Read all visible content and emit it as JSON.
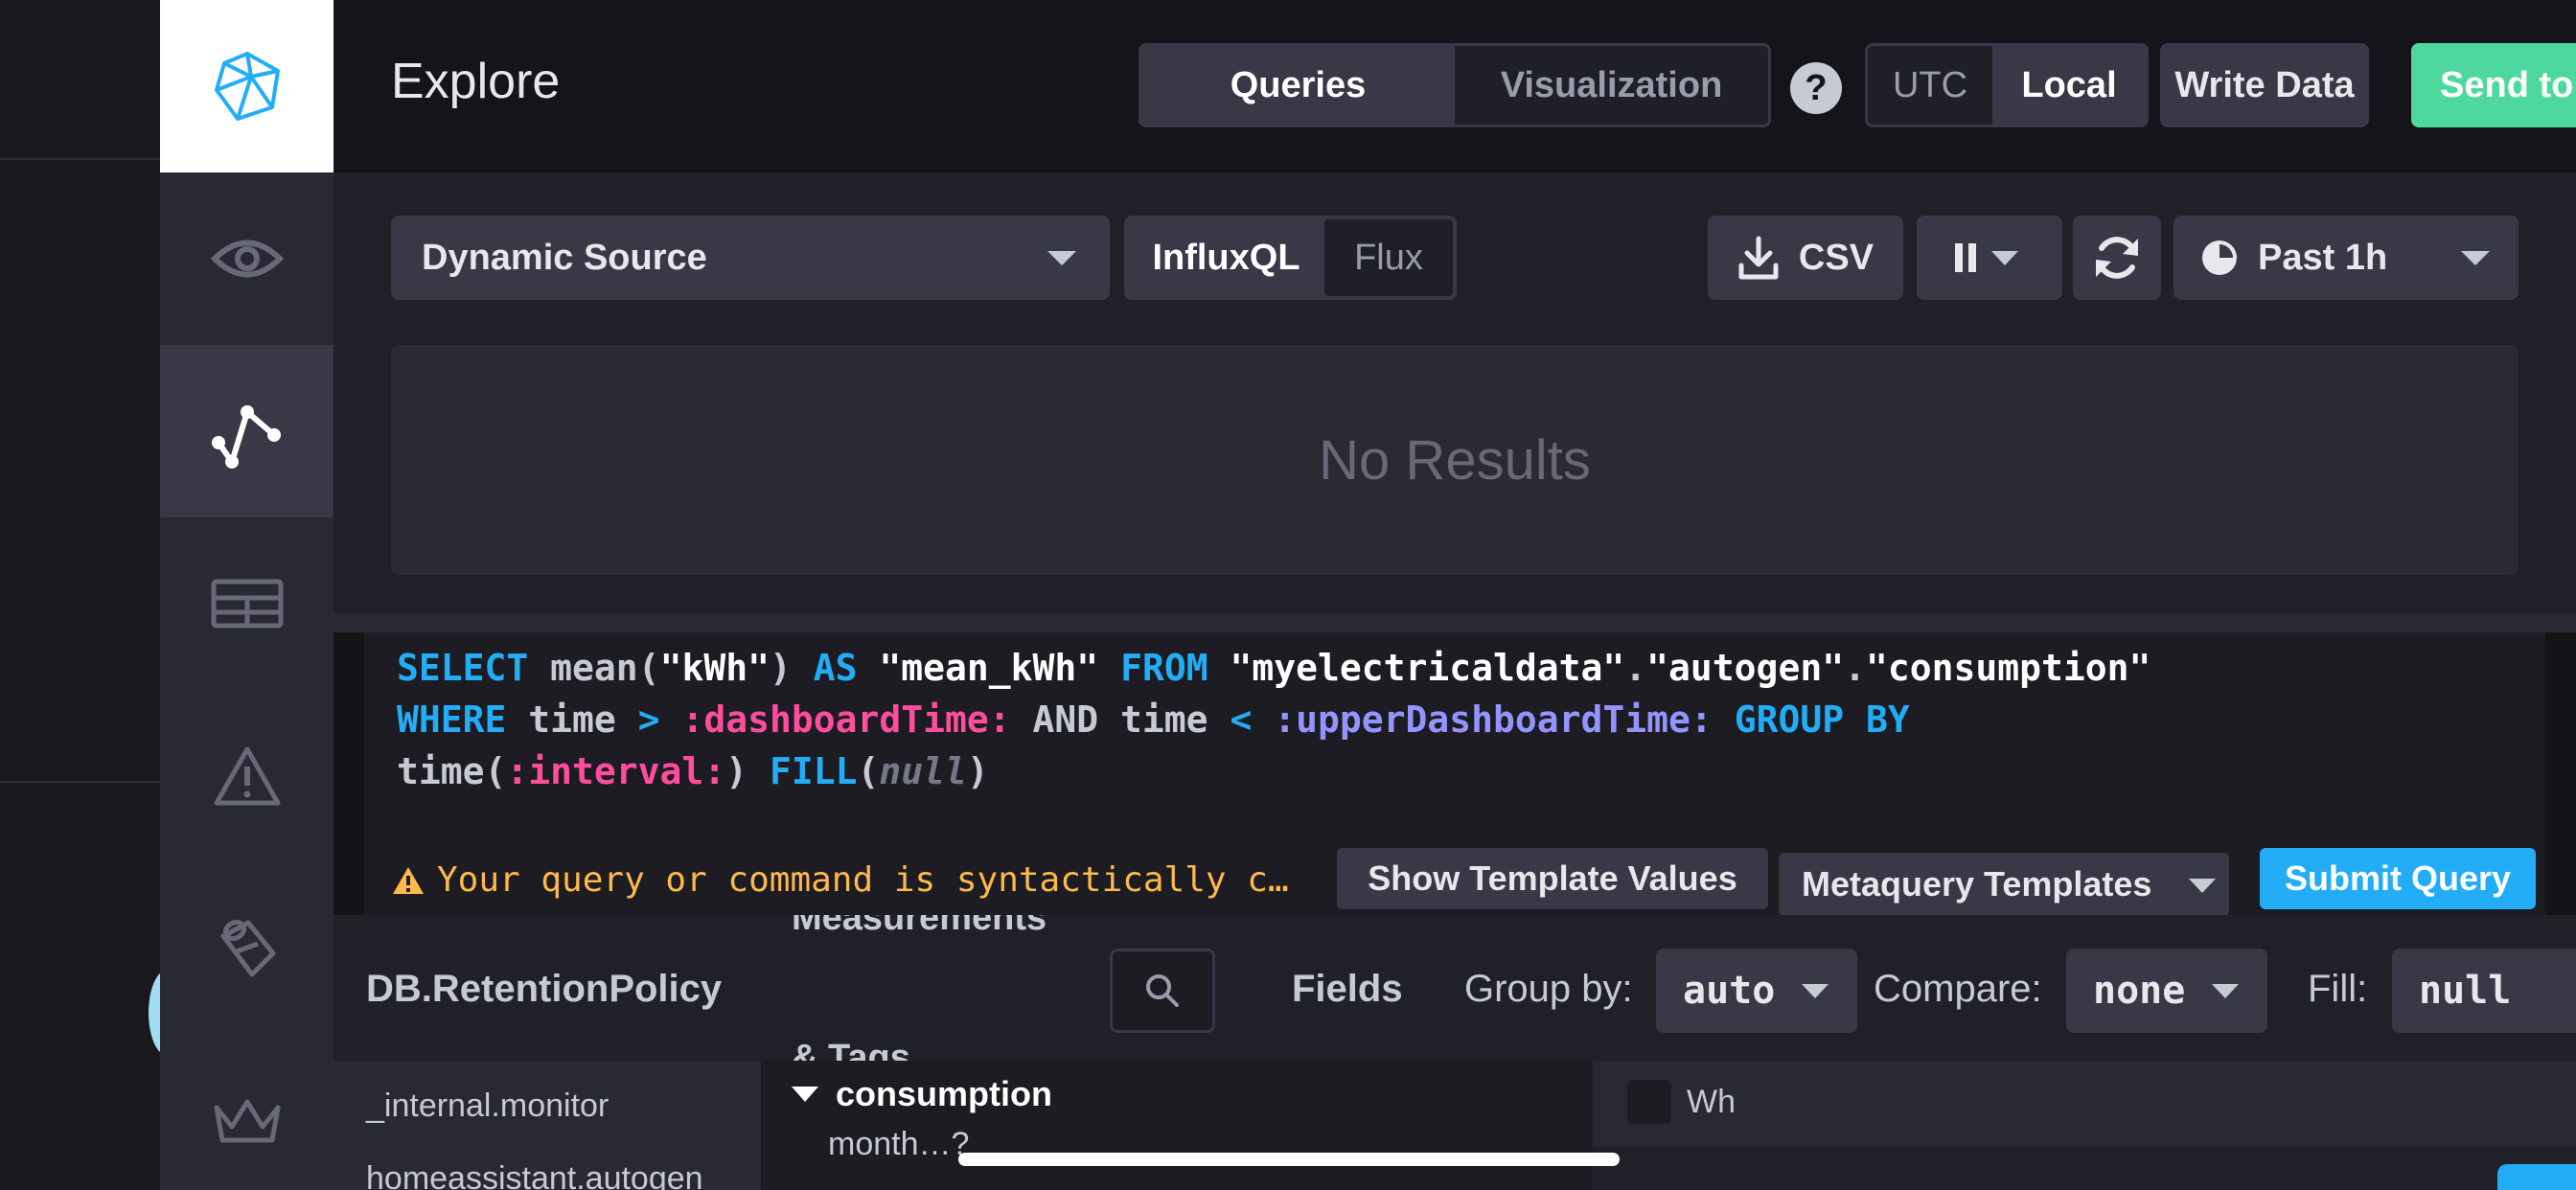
{
  "header": {
    "title": "Explore",
    "tabs": [
      "Queries",
      "Visualization"
    ],
    "help_label": "?",
    "timezones": [
      "UTC",
      "Local"
    ],
    "write_data_label": "Write Data",
    "send_label": "Send to"
  },
  "toolbar": {
    "source": "Dynamic Source",
    "languages": [
      "InfluxQL",
      "Flux"
    ],
    "csv_label": "CSV",
    "range_label": "Past 1h"
  },
  "results": {
    "empty_message": "No Results"
  },
  "query": {
    "status": "Your query or command is syntactically c…",
    "show_templates_label": "Show Template Values",
    "metaquery_label": "Metaquery Templates",
    "submit_label": "Submit Query"
  },
  "schema": {
    "db_title": "DB.RetentionPolicy",
    "measurements_title": "Measurements",
    "tags_title": "& Tags",
    "databases": [
      "_internal.monitor",
      "homeassistant.autogen"
    ],
    "measurement": "consumption",
    "sub_item": "month…?",
    "fields_title": "Fields",
    "group_by_label": "Group by:",
    "group_by_value": "auto",
    "compare_label": "Compare:",
    "compare_value": "none",
    "fill_label": "Fill:",
    "fill_value": "null",
    "field_item": "Wh"
  },
  "colors": {
    "accent_blue": "#22adf6",
    "accent_green": "#4ed8a0",
    "template_pink": "#ff4d9e",
    "template_purple": "#9394ff",
    "warning": "#ffb94a"
  }
}
